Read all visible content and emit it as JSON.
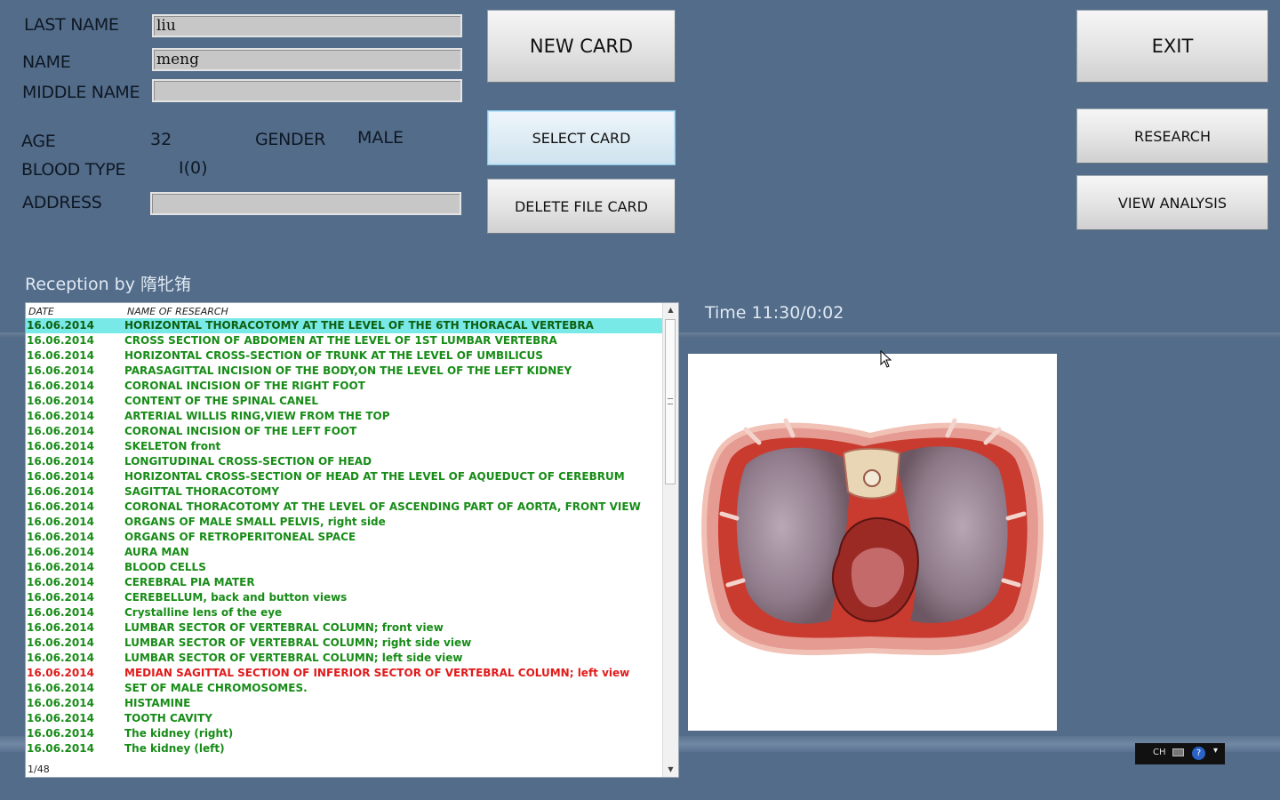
{
  "patient": {
    "last_name_label": "LAST NAME",
    "last_name": "liu",
    "name_label": "NAME",
    "name": "meng",
    "middle_name_label": "MIDDLE NAME",
    "middle_name": "",
    "age_label": "AGE",
    "age": "32",
    "gender_label": "GENDER",
    "gender": "MALE",
    "blood_type_label": "BLOOD TYPE",
    "blood_type": "I(0)",
    "address_label": "ADDRESS",
    "address": ""
  },
  "buttons": {
    "new_card": "NEW CARD",
    "select_card": "SELECT CARD",
    "delete_file_card": "DELETE FILE CARD",
    "exit": "EXIT",
    "research": "RESEARCH",
    "view_analysis": "VIEW ANALYSIS"
  },
  "reception": "Reception by 隋牝铕",
  "time": "Time 11:30/0:02",
  "research_list": {
    "columns": [
      "DATE",
      "NAME OF RESEARCH"
    ],
    "rows": [
      {
        "date": "16.06.2014",
        "name": "HORIZONTAL THORACOTOMY AT THE LEVEL OF THE 6TH THORACAL VERTEBRA"
      },
      {
        "date": "16.06.2014",
        "name": "CROSS SECTION OF ABDOMEN AT THE LEVEL OF 1ST LUMBAR VERTEBRA"
      },
      {
        "date": "16.06.2014",
        "name": "HORIZONTAL CROSS-SECTION OF TRUNK AT THE LEVEL OF UMBILICUS"
      },
      {
        "date": "16.06.2014",
        "name": "PARASAGITTAL INCISION OF THE BODY,ON THE LEVEL OF THE LEFT KIDNEY"
      },
      {
        "date": "16.06.2014",
        "name": "CORONAL INCISION OF THE RIGHT FOOT"
      },
      {
        "date": "16.06.2014",
        "name": "CONTENT OF THE SPINAL CANEL"
      },
      {
        "date": "16.06.2014",
        "name": "ARTERIAL WILLIS RING,VIEW FROM THE TOP"
      },
      {
        "date": "16.06.2014",
        "name": "CORONAL INCISION OF THE LEFT FOOT"
      },
      {
        "date": "16.06.2014",
        "name": "SKELETON front"
      },
      {
        "date": "16.06.2014",
        "name": "LONGITUDINAL CROSS-SECTION OF HEAD"
      },
      {
        "date": "16.06.2014",
        "name": "HORIZONTAL CROSS-SECTION OF HEAD AT THE LEVEL OF AQUEDUCT OF CEREBRUM"
      },
      {
        "date": "16.06.2014",
        "name": "SAGITTAL THORACOTOMY"
      },
      {
        "date": "16.06.2014",
        "name": "CORONAL THORACOTOMY AT THE LEVEL OF ASCENDING PART OF AORTA, FRONT VIEW"
      },
      {
        "date": "16.06.2014",
        "name": "ORGANS OF MALE SMALL PELVIS, right side"
      },
      {
        "date": "16.06.2014",
        "name": "ORGANS OF RETROPERITONEAL SPACE"
      },
      {
        "date": "16.06.2014",
        "name": "AURA MAN"
      },
      {
        "date": "16.06.2014",
        "name": "BLOOD  CELLS"
      },
      {
        "date": "16.06.2014",
        "name": "CEREBRAL  PIA  MATER"
      },
      {
        "date": "16.06.2014",
        "name": "CEREBELLUM,  back  and button  views"
      },
      {
        "date": "16.06.2014",
        "name": "Crystalline lens of the eye"
      },
      {
        "date": "16.06.2014",
        "name": "LUMBAR  SECTOR  OF  VERTEBRAL  COLUMN; front view"
      },
      {
        "date": "16.06.2014",
        "name": "LUMBAR  SECTOR  OF  VERTEBRAL  COLUMN; right side view"
      },
      {
        "date": "16.06.2014",
        "name": "LUMBAR  SECTOR  OF  VERTEBRAL  COLUMN; left side view"
      },
      {
        "date": "16.06.2014",
        "name": "MEDIAN SAGITTAL SECTION OF INFERIOR SECTOR OF VERTEBRAL COLUMN; left view"
      },
      {
        "date": "16.06.2014",
        "name": "SET OF MALE CHROMOSOMES."
      },
      {
        "date": "16.06.2014",
        "name": "HISTAMINE"
      },
      {
        "date": "16.06.2014",
        "name": "TOOTH CAVITY"
      },
      {
        "date": "16.06.2014",
        "name": "The kidney (right)"
      },
      {
        "date": "16.06.2014",
        "name": "The kidney (left)"
      }
    ],
    "selected_index": 0,
    "highlight_red_index": 23,
    "footer": "1/48"
  },
  "tray": {
    "lang": "CH"
  },
  "icons": [
    "scroll-up-arrow-icon",
    "scroll-down-arrow-icon",
    "scroll-grip-icon",
    "keyboard-icon",
    "help-icon",
    "cursor-icon"
  ]
}
